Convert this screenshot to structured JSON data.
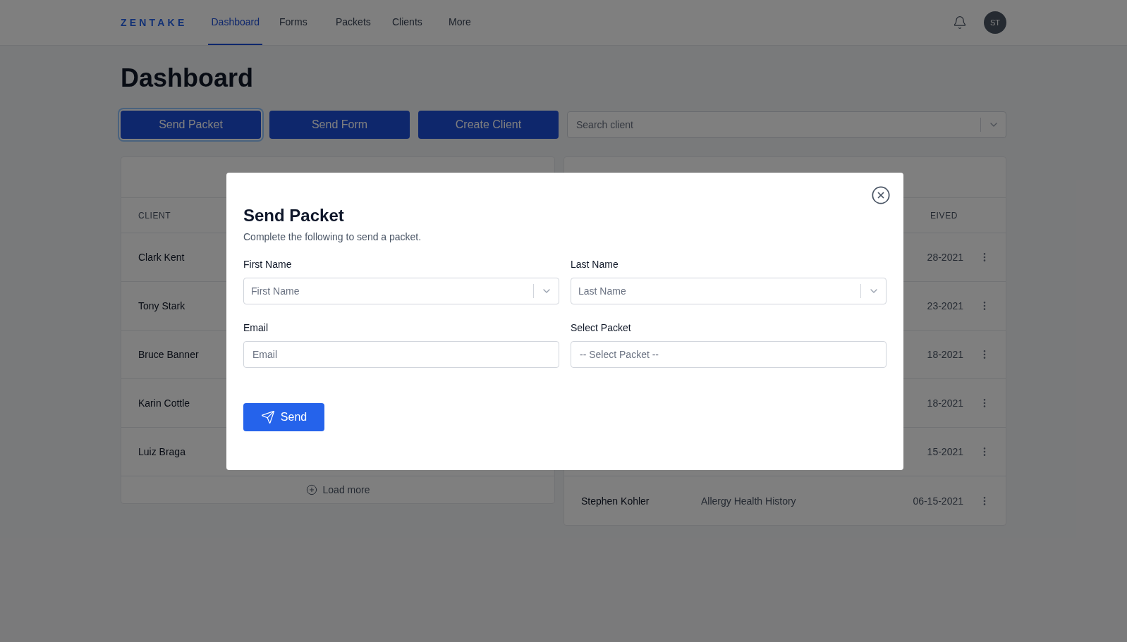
{
  "header": {
    "logo": "ZENTAKE",
    "nav": [
      {
        "label": "Dashboard",
        "selected": true
      },
      {
        "label": "Forms",
        "selected": false
      },
      {
        "label": "Packets",
        "selected": false
      },
      {
        "label": "Clients",
        "selected": false
      },
      {
        "label": "More",
        "selected": false
      }
    ],
    "avatar": "ST"
  },
  "page_title": "Dashboard",
  "actions": [
    {
      "label": "Send Packet",
      "focused": true
    },
    {
      "label": "Send Form",
      "focused": false
    },
    {
      "label": "Create Client",
      "focused": false
    }
  ],
  "search": {
    "placeholder": "Search client"
  },
  "clients_card": {
    "column": "CLIENT",
    "rows": [
      "Clark Kent",
      "Tony Stark",
      "Bruce Banner",
      "Karin Cottle",
      "Luiz Braga"
    ],
    "load_more": "Load more"
  },
  "received_card": {
    "column": "EIVED",
    "rows": [
      {
        "date": "28-2021"
      },
      {
        "date": "23-2021"
      },
      {
        "date": "18-2021"
      },
      {
        "date": "18-2021"
      },
      {
        "date": "15-2021"
      },
      {
        "client": "Stephen Kohler",
        "form": "Allergy Health History",
        "date": "06-15-2021"
      }
    ]
  },
  "modal": {
    "title": "Send Packet",
    "subtitle": "Complete the following to send a packet.",
    "fields": [
      {
        "label": "First Name",
        "placeholder": "First Name",
        "kind": "combobox"
      },
      {
        "label": "Last Name",
        "placeholder": "Last Name",
        "kind": "combobox"
      },
      {
        "label": "Email",
        "placeholder": "Email",
        "kind": "text"
      },
      {
        "label": "Select Packet",
        "placeholder": "-- Select Packet --",
        "kind": "select"
      }
    ],
    "submit": "Send"
  }
}
